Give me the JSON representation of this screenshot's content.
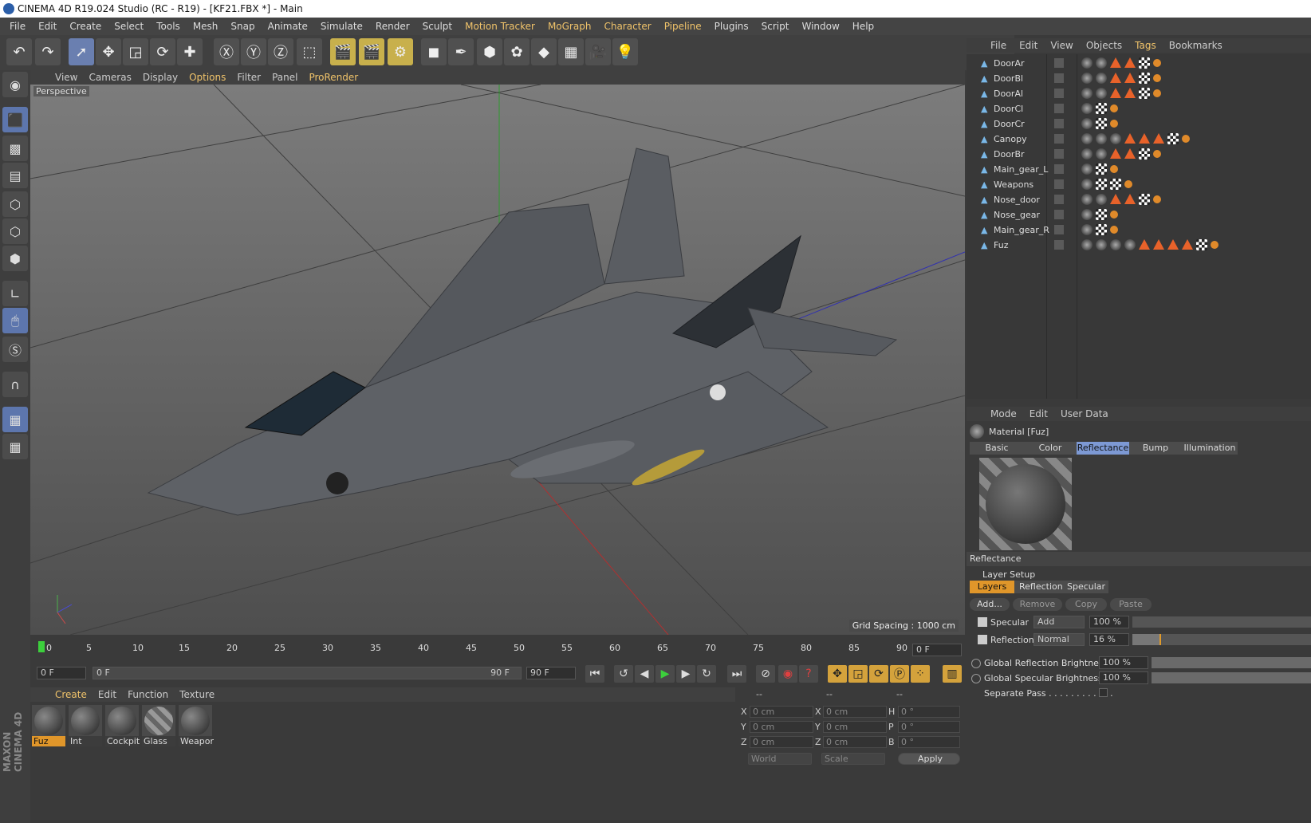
{
  "window": {
    "title": "CINEMA 4D R19.024 Studio (RC - R19) - [KF21.FBX *] - Main"
  },
  "menubar": [
    "File",
    "Edit",
    "Create",
    "Select",
    "Tools",
    "Mesh",
    "Snap",
    "Animate",
    "Simulate",
    "Render",
    "Sculpt",
    "Motion Tracker",
    "MoGraph",
    "Character",
    "Pipeline",
    "Plugins",
    "Script",
    "Window",
    "Help"
  ],
  "viewport": {
    "menu": [
      "View",
      "Cameras",
      "Display",
      "Options",
      "Filter",
      "Panel",
      "ProRender"
    ],
    "label": "Perspective",
    "grid_spacing": "Grid Spacing : 1000 cm"
  },
  "timeline": {
    "ticks": [
      "0",
      "5",
      "10",
      "15",
      "20",
      "25",
      "30",
      "35",
      "40",
      "45",
      "50",
      "55",
      "60",
      "65",
      "70",
      "75",
      "80",
      "85",
      "90"
    ],
    "end_frame_field": "0 F",
    "current_frame": "0 F",
    "range_start": "0 F",
    "range_end": "90 F",
    "max_frame": "90 F"
  },
  "material_manager": {
    "menu": [
      "Create",
      "Edit",
      "Function",
      "Texture"
    ],
    "materials": [
      "Fuz",
      "Int",
      "Cockpit",
      "Glass",
      "Weapor"
    ]
  },
  "coordinates": {
    "headers": [
      "--",
      "--",
      "--"
    ],
    "rows": [
      {
        "a": "X",
        "av": "0 cm",
        "b": "X",
        "bv": "0 cm",
        "c": "H",
        "cv": "0 °"
      },
      {
        "a": "Y",
        "av": "0 cm",
        "b": "Y",
        "bv": "0 cm",
        "c": "P",
        "cv": "0 °"
      },
      {
        "a": "Z",
        "av": "0 cm",
        "b": "Z",
        "bv": "0 cm",
        "c": "B",
        "cv": "0 °"
      }
    ],
    "world": "World",
    "scale": "Scale",
    "apply": "Apply"
  },
  "object_manager": {
    "menu": [
      "File",
      "Edit",
      "View",
      "Objects",
      "Tags",
      "Bookmarks"
    ],
    "objects": [
      "DoorAr",
      "DoorBl",
      "DoorAl",
      "DoorCl",
      "DoorCr",
      "Canopy",
      "DoorBr",
      "Main_gear_L",
      "Weapons",
      "Nose_door",
      "Nose_gear",
      "Main_gear_R",
      "Fuz"
    ]
  },
  "attributes": {
    "menu": [
      "Mode",
      "Edit",
      "User Data"
    ],
    "title": "Material [Fuz]",
    "tabs": [
      "Basic",
      "Color",
      "Reflectance",
      "Bump",
      "Illumination"
    ],
    "section": "Reflectance",
    "layer_setup": "Layer Setup",
    "subtabs": [
      "Layers",
      "Reflection",
      "Specular"
    ],
    "buttons": [
      "Add...",
      "Remove",
      "Copy",
      "Paste"
    ],
    "layers": [
      {
        "name": "Specular",
        "mode": "Add",
        "value": "100 %",
        "fill": 0
      },
      {
        "name": "Reflection",
        "mode": "Normal",
        "value": "16 %",
        "fill": 0.16
      }
    ],
    "global_reflection": {
      "label": "Global Reflection Brightness",
      "value": "100 %"
    },
    "global_specular": {
      "label": "Global Specular Brightness",
      "value": "100 %"
    },
    "separate_pass": "Separate Pass . . . . . . . . . . . ."
  },
  "brand": "MAXON CINEMA 4D"
}
